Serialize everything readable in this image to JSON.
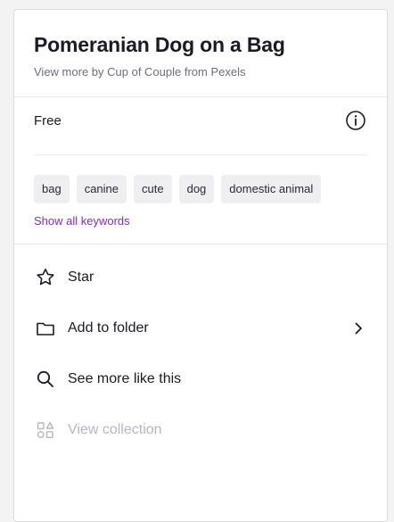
{
  "header": {
    "title": "Pomeranian Dog on a Bag",
    "subtitle": "View more by Cup of Couple from Pexels"
  },
  "license": {
    "label": "Free",
    "info_icon": "info-icon"
  },
  "keywords": {
    "items": [
      "bag",
      "canine",
      "cute",
      "dog",
      "domestic animal"
    ],
    "show_all_label": "Show all keywords"
  },
  "actions": [
    {
      "label": "Star",
      "icon": "star-icon",
      "enabled": true
    },
    {
      "label": "Add to folder",
      "icon": "folder-icon",
      "enabled": true,
      "has_submenu": true
    },
    {
      "label": "See more like this",
      "icon": "search-icon",
      "enabled": true
    },
    {
      "label": "View collection",
      "icon": "collection-icon",
      "enabled": false
    }
  ],
  "colors": {
    "accent": "#7d2ae8",
    "text": "#1b1b24",
    "muted": "#6c6f78",
    "disabled": "#b6b7bd",
    "chip_bg": "#efeff1"
  }
}
